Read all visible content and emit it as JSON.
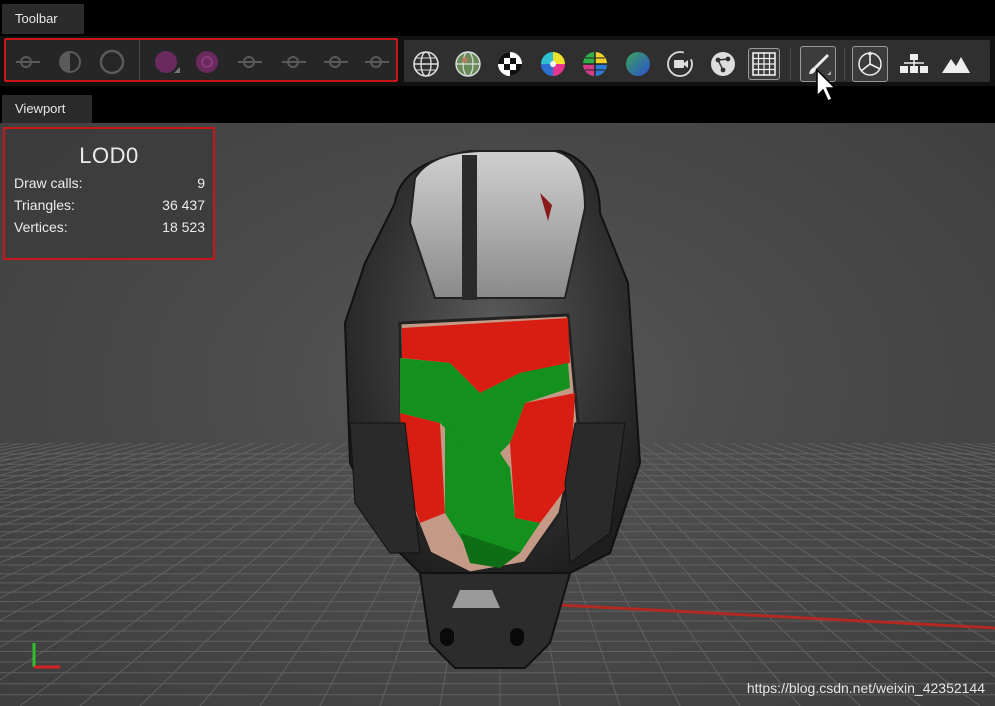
{
  "toolbar": {
    "tab_label": "Toolbar"
  },
  "viewport": {
    "tab_label": "Viewport"
  },
  "stats": {
    "lod": "LOD0",
    "rows": [
      {
        "label": "Draw calls:",
        "value": "9"
      },
      {
        "label": "Triangles:",
        "value": "36 437"
      },
      {
        "label": "Vertices:",
        "value": "18 523"
      }
    ]
  },
  "disabled_group_icons": [
    "slider-icon",
    "half-circle-icon",
    "circle-outline-icon",
    "magenta-sphere-icon",
    "magenta-ring-icon",
    "slider-icon",
    "slider-icon",
    "slider-icon",
    "slider-icon"
  ],
  "main_group_icons": [
    "wireframe-sphere-icon",
    "textured-sphere-icon",
    "checker-icon",
    "color-wheel-icon",
    "color-grid-icon",
    "gradient-sphere-icon",
    "camera-icon",
    "graph-nodes-icon",
    "grid-icon",
    "paint-brush-icon",
    "transform-gizmo-icon",
    "hierarchy-icon",
    "terrain-icon"
  ],
  "watermark": "https://blog.csdn.net/weixin_42352144",
  "colors": {
    "accent_red": "#c8161d",
    "highlight_green": "#1f8f1f"
  }
}
